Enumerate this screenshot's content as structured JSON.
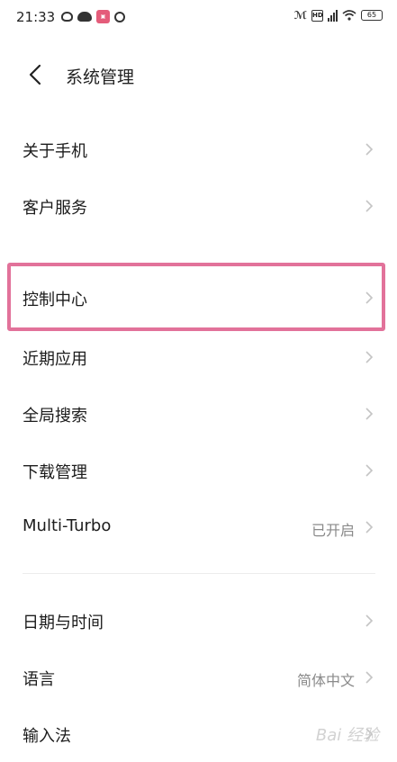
{
  "status_bar": {
    "time": "21:33",
    "battery": "65"
  },
  "header": {
    "title": "系统管理"
  },
  "groups": [
    {
      "items": [
        {
          "label": "关于手机",
          "value": ""
        },
        {
          "label": "客户服务",
          "value": ""
        }
      ]
    },
    {
      "items": [
        {
          "label": "控制中心",
          "value": "",
          "highlighted": true
        },
        {
          "label": "近期应用",
          "value": ""
        },
        {
          "label": "全局搜索",
          "value": ""
        },
        {
          "label": "下载管理",
          "value": ""
        },
        {
          "label": "Multi-Turbo",
          "value": "已开启"
        }
      ]
    },
    {
      "items": [
        {
          "label": "日期与时间",
          "value": ""
        },
        {
          "label": "语言",
          "value": "简体中文"
        },
        {
          "label": "输入法",
          "value": ""
        }
      ]
    }
  ],
  "highlight_color": "#e2729a",
  "watermark": "Bai 经验"
}
